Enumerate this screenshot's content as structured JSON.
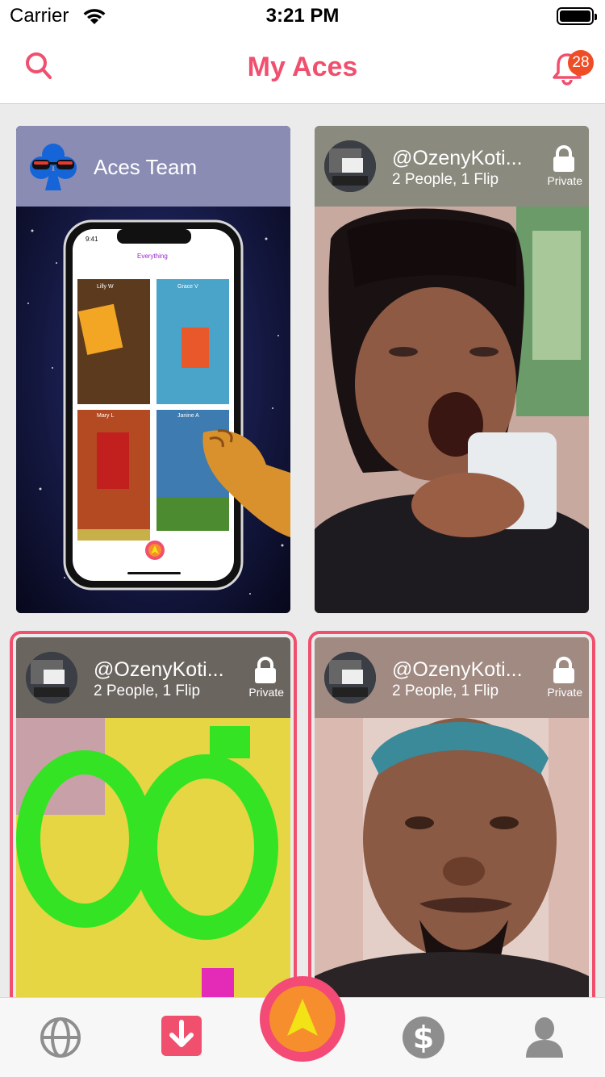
{
  "status_bar": {
    "carrier": "Carrier",
    "time": "3:21 PM"
  },
  "header": {
    "title": "My Aces",
    "notification_count": "28"
  },
  "cards": [
    {
      "name": "Aces Team"
    },
    {
      "name": "@OzenyKoti...",
      "subtitle": "2 People, 1 Flip",
      "privacy": "Private"
    },
    {
      "name": "@OzenyKoti...",
      "subtitle": "2 People, 1 Flip",
      "privacy": "Private"
    },
    {
      "name": "@OzenyKoti...",
      "subtitle": "2 People, 1 Flip",
      "privacy": "Private"
    }
  ],
  "promo_phone": {
    "time": "9:41",
    "title": "Everything",
    "tiles": [
      "Lilly W",
      "Grace V",
      "Mary L",
      "Janine A"
    ]
  },
  "colors": {
    "accent": "#f0506e",
    "badge": "#ef4d25",
    "center_button_outer": "#f44a76",
    "center_button_inner": "#f78e2d",
    "arrow": "#f2e316"
  },
  "tabbar": {
    "icons": [
      "globe-icon",
      "download-icon",
      "ace-arrow-icon",
      "dollar-icon",
      "profile-icon"
    ]
  }
}
